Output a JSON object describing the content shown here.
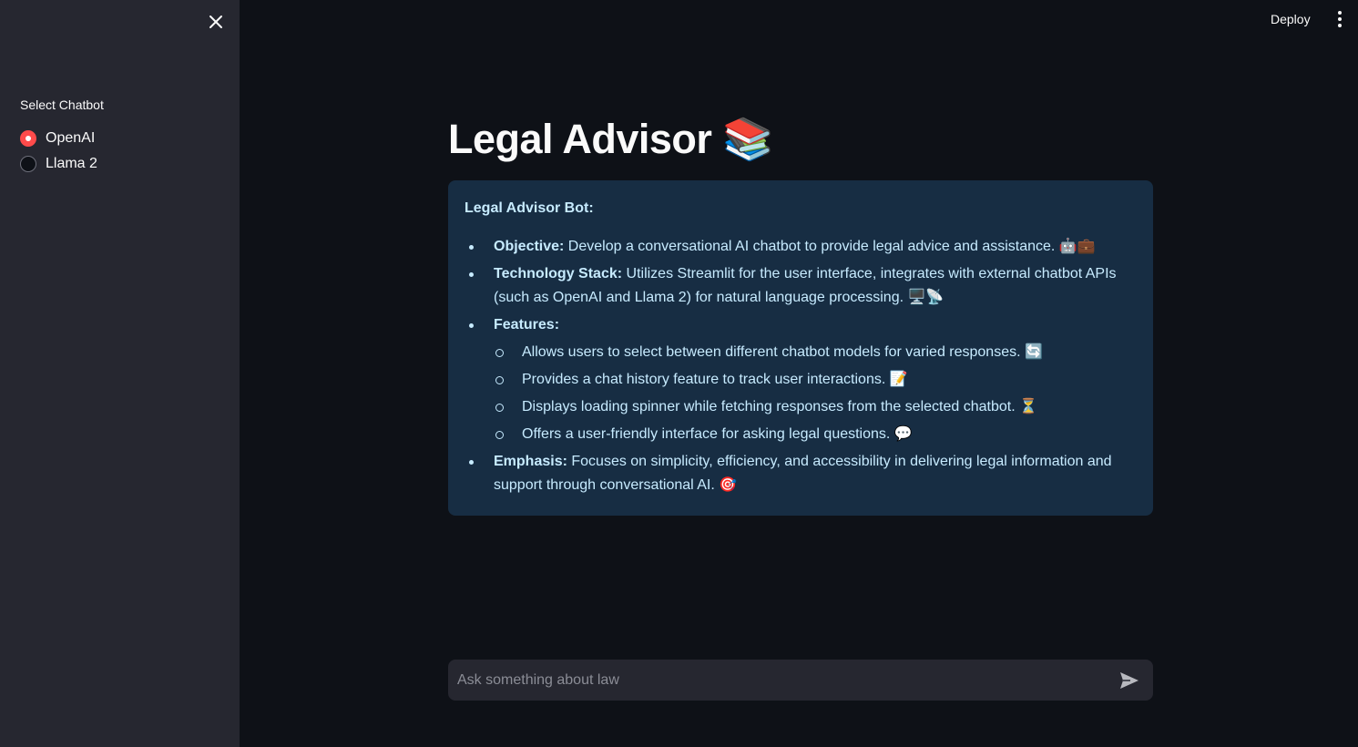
{
  "sidebar": {
    "radio_label": "Select Chatbot",
    "options": [
      {
        "label": "OpenAI",
        "checked": true
      },
      {
        "label": "Llama 2",
        "checked": false
      }
    ]
  },
  "header": {
    "deploy_label": "Deploy"
  },
  "main": {
    "title": "Legal Advisor 📚",
    "info": {
      "heading": "Legal Advisor Bot:",
      "objective_label": "Objective:",
      "objective_text": " Develop a conversational AI chatbot to provide legal advice and assistance. 🤖💼",
      "tech_label": "Technology Stack:",
      "tech_text": " Utilizes Streamlit for the user interface, integrates with external chatbot APIs (such as OpenAI and Llama 2) for natural language processing. 🖥️📡",
      "features_label": "Features:",
      "features": [
        "Allows users to select between different chatbot models for varied responses. 🔄",
        "Provides a chat history feature to track user interactions. 📝",
        "Displays loading spinner while fetching responses from the selected chatbot. ⏳",
        "Offers a user-friendly interface for asking legal questions. 💬"
      ],
      "emphasis_label": "Emphasis:",
      "emphasis_text": " Focuses on simplicity, efficiency, and accessibility in delivering legal information and support through conversational AI. 🎯"
    }
  },
  "chat": {
    "placeholder": "Ask something about law",
    "value": ""
  },
  "colors": {
    "accent": "#ff4b4b",
    "sidebar_bg": "#262730",
    "main_bg": "#0e1117",
    "info_bg": "#172d43",
    "info_text": "#c7ebff"
  },
  "icons": {
    "close": "close-icon",
    "menu": "kebab-menu-icon",
    "send": "send-icon"
  }
}
